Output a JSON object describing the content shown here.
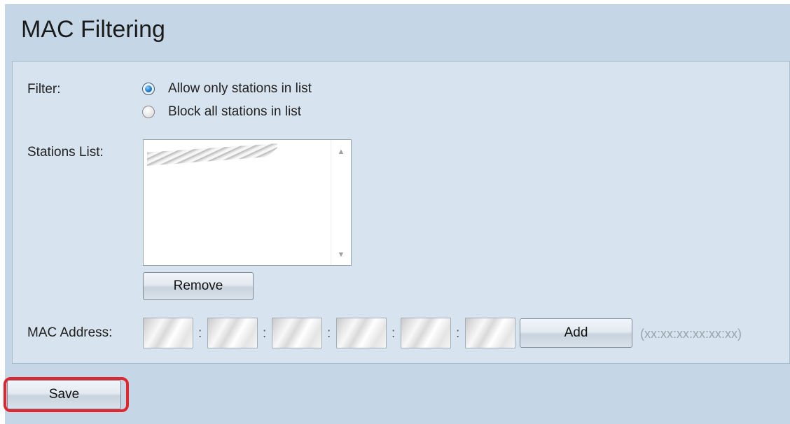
{
  "page": {
    "title": "MAC Filtering"
  },
  "filter": {
    "label": "Filter:",
    "options": [
      {
        "label": "Allow only stations in list",
        "checked": true
      },
      {
        "label": "Block all stations in list",
        "checked": false
      }
    ]
  },
  "stations": {
    "label": "Stations List:",
    "remove_label": "Remove"
  },
  "mac": {
    "label": "MAC Address:",
    "separator": ":",
    "add_label": "Add",
    "hint": "(xx:xx:xx:xx:xx:xx)"
  },
  "footer": {
    "save_label": "Save"
  },
  "icons": {
    "scroll_up": "scroll-up-arrow",
    "scroll_down": "scroll-down-arrow"
  },
  "colors": {
    "highlight": "#e3262d",
    "background": "#c5d7e6",
    "panel": "#d7e3ee"
  }
}
